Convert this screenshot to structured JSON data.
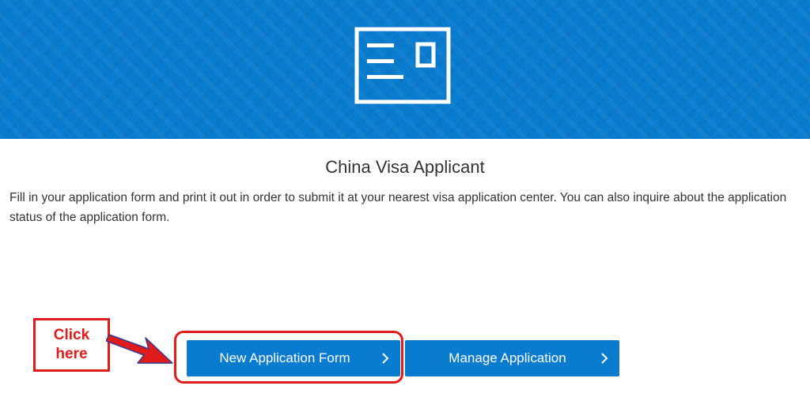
{
  "page": {
    "title": "China Visa Applicant",
    "description": "Fill in your application form and print it out in order to submit it at your nearest visa application center. You can also inquire about the application status of the application form."
  },
  "hero": {
    "icon": "application-form-card-icon",
    "background_color": "#0a7ccf"
  },
  "buttons": {
    "new_application": "New Application Form",
    "manage_application": "Manage Application"
  },
  "annotation": {
    "callout_text": "Click\nhere",
    "color": "#e01b1b"
  },
  "colors": {
    "primary": "#0a7ccf",
    "text": "#333333",
    "annotation": "#e01b1b"
  }
}
